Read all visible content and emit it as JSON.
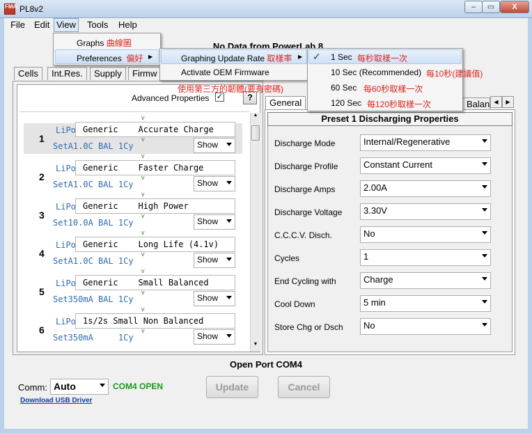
{
  "window": {
    "title": "PL8v2",
    "icon_text": "FMA",
    "min_label": "–",
    "max_label": "▭",
    "close_label": "X"
  },
  "menubar": {
    "file": "File",
    "edit": "Edit",
    "view": "View",
    "tools": "Tools",
    "help": "Help"
  },
  "view_menu": {
    "graphs": "Graphs",
    "graphs_cn": "曲線圖",
    "preferences": "Preferences",
    "preferences_cn": "偏好"
  },
  "preferences_menu": {
    "graphing_rate": "Graphing Update Rate",
    "graphing_rate_cn": "取樣率",
    "activate_oem": "Activate OEM Firmware",
    "activate_oem_cn": "使用第三方的韌體(要有密碼)"
  },
  "rate_menu": [
    {
      "label": "1 Sec",
      "cn": "每秒取樣一次",
      "checked": true
    },
    {
      "label": "10 Sec (Recommended)",
      "cn": "每10秒(建議值)",
      "checked": false
    },
    {
      "label": "60 Sec",
      "cn": "每60秒取樣一次",
      "checked": false
    },
    {
      "label": "120 Sec",
      "cn": "每120秒取樣一次",
      "checked": false
    }
  ],
  "header": {
    "status": "No Data from PowerLab 8"
  },
  "tabs": {
    "cells": "Cells",
    "int_res": "Int.Res.",
    "supply": "Supply",
    "firmware": "Firmw"
  },
  "left": {
    "advanced_label": "Advanced Properties",
    "help_label": "?"
  },
  "presets": [
    {
      "num": "1",
      "chem": "LiPo",
      "name": "Generic    Accurate Charge",
      "setting": "SetA1.0C BAL 1Cy",
      "show": "Show"
    },
    {
      "num": "2",
      "chem": "LiPo",
      "name": "Generic    Faster Charge",
      "setting": "SetA1.0C BAL 1Cy",
      "show": "Show"
    },
    {
      "num": "3",
      "chem": "LiPo",
      "name": "Generic    High Power",
      "setting": "Set10.0A BAL 1Cy",
      "show": "Show"
    },
    {
      "num": "4",
      "chem": "LiPo",
      "name": "Generic    Long Life (4.1v)",
      "setting": "SetA1.0C BAL 1Cy",
      "show": "Show"
    },
    {
      "num": "5",
      "chem": "LiPo",
      "name": "Generic    Small Balanced",
      "setting": "Set350mA BAL 1Cy",
      "show": "Show"
    },
    {
      "num": "6",
      "chem": "LiPo",
      "name": "1s/2s Small Non Balanced",
      "setting": "Set350mA     1Cy",
      "show": "Show"
    }
  ],
  "right": {
    "tab_general": "General",
    "tab_balance": "Balanc",
    "section_title": "Preset 1  Discharging Properties"
  },
  "properties": [
    {
      "label": "Discharge Mode",
      "value": "Internal/Regenerative"
    },
    {
      "label": "Discharge Profile",
      "value": "Constant Current"
    },
    {
      "label": "Discharge Amps",
      "value": "2.00A"
    },
    {
      "label": "Discharge Voltage",
      "value": "3.30V"
    },
    {
      "label": "C.C.C.V. Disch.",
      "value": "No"
    },
    {
      "label": "Cycles",
      "value": "1"
    },
    {
      "label": "End Cycling with",
      "value": "Charge"
    },
    {
      "label": "Cool Down",
      "value": "5 min"
    },
    {
      "label": "Store Chg or Dsch",
      "value": "No"
    }
  ],
  "footer": {
    "open_port": "Open Port COM4",
    "comm_label": "Comm:",
    "comm_value": "Auto",
    "com_status": "COM4 OPEN",
    "update": "Update",
    "cancel": "Cancel",
    "download": "Download USB Driver"
  },
  "colors": {
    "com_status": "#1a9a1a",
    "annotation": "#e0241b",
    "link": "#0b3ea8"
  }
}
